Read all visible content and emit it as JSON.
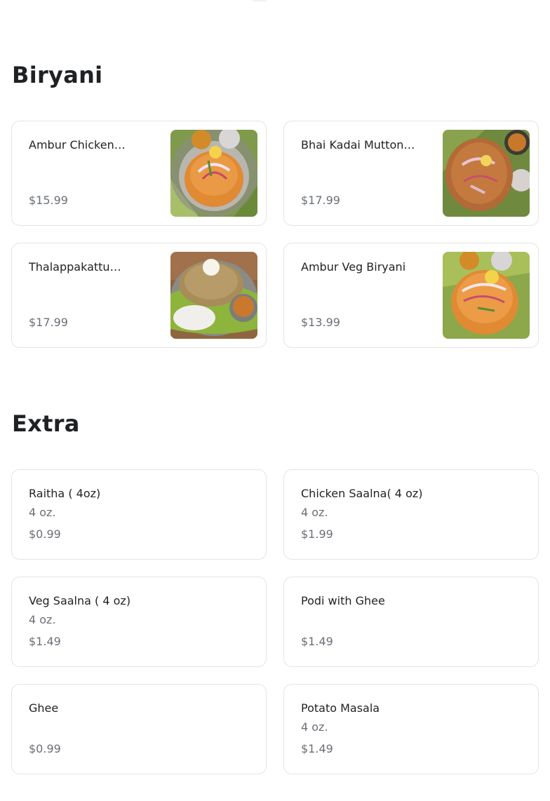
{
  "sections": [
    {
      "title": "Biryani",
      "items": [
        {
          "name": "Ambur Chicken…",
          "price": "$15.99",
          "image": "ambur-chicken-biryani-photo"
        },
        {
          "name": "Bhai Kadai Mutton…",
          "price": "$17.99",
          "image": "bhai-kadai-mutton-biryani-photo"
        },
        {
          "name": "Thalappakattu…",
          "price": "$17.99",
          "image": "thalappakattu-biryani-photo"
        },
        {
          "name": "Ambur Veg Biryani",
          "price": "$13.99",
          "image": "ambur-veg-biryani-photo"
        }
      ]
    },
    {
      "title": "Extra",
      "items": [
        {
          "name": "Raitha ( 4oz)",
          "desc": "4 oz.",
          "price": "$0.99"
        },
        {
          "name": "Chicken Saalna( 4 oz)",
          "desc": "4 oz.",
          "price": "$1.99"
        },
        {
          "name": "Veg Saalna ( 4 oz)",
          "desc": "4 oz.",
          "price": "$1.49"
        },
        {
          "name": "Podi with Ghee",
          "desc": "",
          "price": "$1.49"
        },
        {
          "name": "Ghee",
          "desc": "",
          "price": "$0.99"
        },
        {
          "name": "Potato Masala",
          "desc": "4 oz.",
          "price": "$1.49"
        }
      ]
    }
  ]
}
